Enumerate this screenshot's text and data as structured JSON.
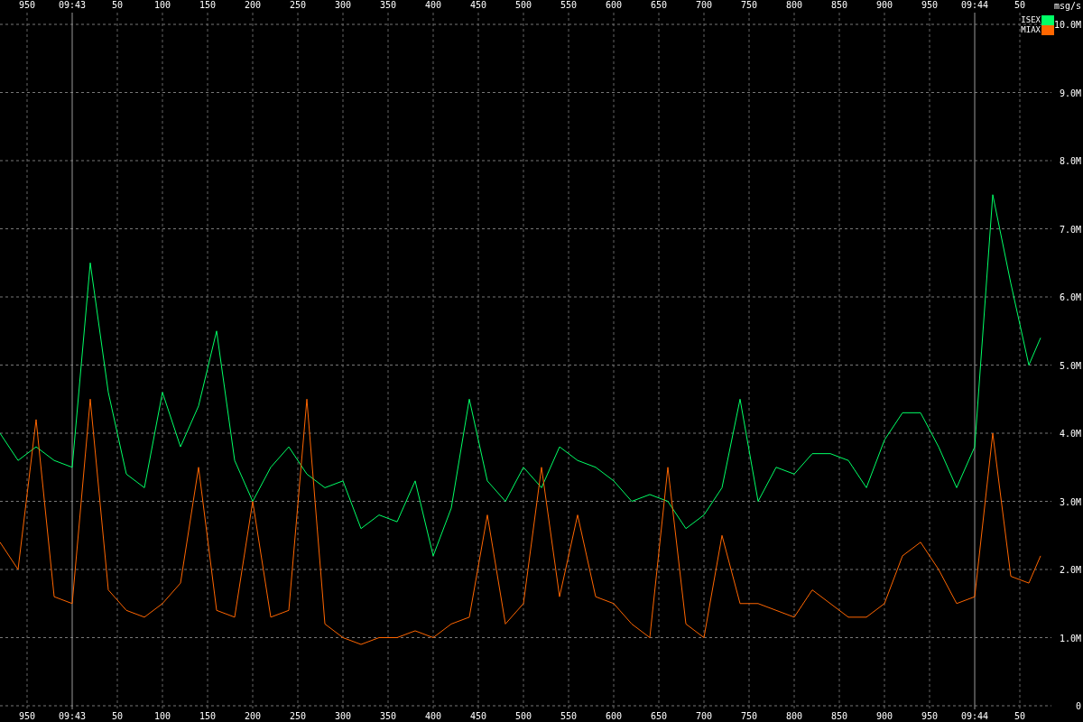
{
  "chart": {
    "chart_data": {
      "type": "line",
      "ylabel": "msg/s",
      "xlim": [
        -80,
        1085
      ],
      "ylim": [
        0,
        10
      ],
      "x": [
        -80,
        -60,
        -40,
        -20,
        0,
        20,
        40,
        60,
        80,
        100,
        120,
        140,
        160,
        180,
        200,
        220,
        240,
        260,
        280,
        300,
        320,
        340,
        360,
        380,
        400,
        420,
        440,
        460,
        480,
        500,
        520,
        540,
        560,
        580,
        600,
        620,
        640,
        660,
        680,
        700,
        720,
        740,
        760,
        780,
        800,
        820,
        840,
        860,
        880,
        900,
        920,
        940,
        960,
        980,
        1000,
        1020,
        1040,
        1060,
        1073
      ],
      "series": [
        {
          "name": "ISEX",
          "color": "#00ff66",
          "values": [
            4.0,
            3.6,
            3.8,
            3.6,
            3.5,
            6.5,
            4.6,
            3.4,
            3.2,
            4.6,
            3.8,
            4.4,
            5.5,
            3.6,
            3.0,
            3.5,
            3.8,
            3.4,
            3.2,
            3.3,
            2.6,
            2.8,
            2.7,
            3.3,
            2.2,
            2.9,
            4.5,
            3.3,
            3.0,
            3.5,
            3.2,
            3.8,
            3.6,
            3.5,
            3.3,
            3.0,
            3.1,
            3.0,
            2.6,
            2.8,
            3.2,
            4.5,
            3.0,
            3.5,
            3.4,
            3.7,
            3.7,
            3.6,
            3.2,
            3.9,
            4.3,
            4.3,
            3.8,
            3.2,
            3.8,
            7.5,
            6.2,
            5.0,
            5.4
          ]
        },
        {
          "name": "MIAX",
          "color": "#ff6600",
          "values": [
            2.4,
            2.0,
            4.2,
            1.6,
            1.5,
            4.5,
            1.7,
            1.4,
            1.3,
            1.5,
            1.8,
            3.5,
            1.4,
            1.3,
            3.0,
            1.3,
            1.4,
            4.5,
            1.2,
            1.0,
            0.9,
            1.0,
            1.0,
            1.1,
            1.0,
            1.2,
            1.3,
            2.8,
            1.2,
            1.5,
            3.5,
            1.6,
            2.8,
            1.6,
            1.5,
            1.2,
            1.0,
            3.5,
            1.2,
            1.0,
            2.5,
            1.5,
            1.5,
            1.4,
            1.3,
            1.7,
            1.5,
            1.3,
            1.3,
            1.5,
            2.2,
            2.4,
            2.0,
            1.5,
            1.6,
            4.0,
            1.9,
            1.8,
            2.2
          ]
        }
      ],
      "xticks": [
        50,
        100,
        150,
        200,
        250,
        300,
        350,
        400,
        450,
        500,
        550,
        600,
        650,
        700,
        750,
        800,
        850,
        900,
        950
      ],
      "grid": true,
      "legend": true,
      "ref_lines": [
        {
          "axis": "x",
          "value": 0
        },
        {
          "axis": "x",
          "value": 1000
        }
      ],
      "yticks": [
        {
          "value": 0,
          "label": "0"
        },
        {
          "value": 1,
          "label": "1.0M"
        },
        {
          "value": 2,
          "label": "2.0M"
        },
        {
          "value": 3,
          "label": "3.0M"
        },
        {
          "value": 4,
          "label": "4.0M"
        },
        {
          "value": 5,
          "label": "5.0M"
        },
        {
          "value": 6,
          "label": "6.0M"
        },
        {
          "value": 7,
          "label": "7.0M"
        },
        {
          "value": 8,
          "label": "8.0M"
        },
        {
          "value": 9,
          "label": "9.0M"
        },
        {
          "value": 10,
          "label": "10.0M"
        }
      ]
    },
    "bottom_edge_labels": [
      "950",
      "09:43",
      "09:44",
      "50"
    ],
    "top_axis_labels": [
      "950",
      "09:43",
      "50",
      "100",
      "150",
      "200",
      "250",
      "300",
      "350",
      "400",
      "450",
      "500",
      "550",
      "600",
      "650",
      "700",
      "750",
      "800",
      "850",
      "900",
      "950",
      "09:44",
      "50"
    ]
  }
}
